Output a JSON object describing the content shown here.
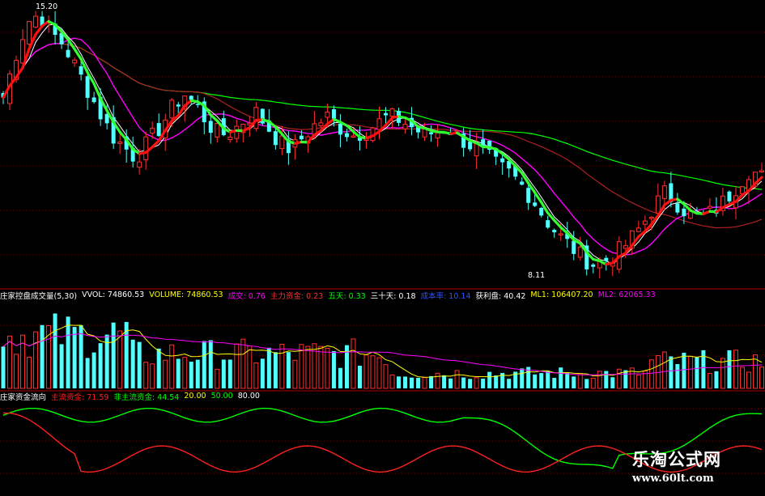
{
  "price_panel": {
    "high_label": "15.20",
    "low_label": "8.11"
  },
  "volume_panel": {
    "items": [
      {
        "text": "庄家控盘成交量(5,30)",
        "color": "#ffffff"
      },
      {
        "text": "VVOL: 74860.53",
        "color": "#ffffff"
      },
      {
        "text": "VOLUME: 74860.53",
        "color": "#ffff00"
      },
      {
        "text": "成交: 0.76",
        "color": "#ff00ff"
      },
      {
        "text": "主力资金: 0.23",
        "color": "#ff3030"
      },
      {
        "text": "五天: 0.33",
        "color": "#00ff00"
      },
      {
        "text": "三十天: 0.18",
        "color": "#ffffff"
      },
      {
        "text": "成本率: 10.14",
        "color": "#3050ff"
      },
      {
        "text": "获利盘: 40.42",
        "color": "#ffffff"
      },
      {
        "text": "ML1: 106407.20",
        "color": "#ffff00"
      },
      {
        "text": "ML2: 62065.33",
        "color": "#ff00ff"
      }
    ]
  },
  "fund_panel": {
    "items": [
      {
        "text": "庄家资金流向",
        "color": "#ffffff"
      },
      {
        "text": "主流资金: 71.59",
        "color": "#ff2020"
      },
      {
        "text": "非主流资金: 44.54",
        "color": "#00ff00"
      },
      {
        "text": "20.00",
        "color": "#ffff00"
      },
      {
        "text": "50.00",
        "color": "#00ff00"
      },
      {
        "text": "80.00",
        "color": "#ffffff"
      }
    ]
  },
  "watermark": {
    "title": "乐淘公式网",
    "url": "www.60lt.com"
  },
  "colors": {
    "up": "#ff3030",
    "down": "#54ffff",
    "ma5": "#ffffff",
    "ma10": "#ff00ff",
    "ma20": "#ff3030",
    "ma60": "#00ff00",
    "grid": "#6b0000",
    "divider": "#b00000"
  },
  "chart_data": {
    "type": "candlestick",
    "instrument_high": 15.2,
    "instrument_low": 8.11,
    "close_path": [
      12.8,
      13.9,
      14.8,
      15.0,
      14.5,
      14.2,
      13.6,
      13.0,
      12.4,
      11.8,
      11.5,
      11.2,
      11.6,
      12.0,
      12.5,
      12.9,
      12.6,
      12.1,
      11.8,
      11.9,
      12.2,
      12.4,
      12.0,
      11.6,
      11.4,
      11.8,
      12.1,
      12.3,
      12.0,
      11.8,
      11.9,
      12.1,
      12.3,
      12.2,
      12.0,
      11.8,
      11.9,
      12.0,
      11.7,
      11.5,
      11.3,
      11.0,
      10.8,
      10.5,
      10.1,
      9.6,
      9.2,
      8.9,
      8.6,
      8.4,
      8.5,
      8.7,
      9.0,
      9.4,
      9.9,
      10.3,
      10.0,
      9.7,
      9.6,
      9.8,
      10.1,
      10.5,
      10.9,
      10.7
    ]
  }
}
